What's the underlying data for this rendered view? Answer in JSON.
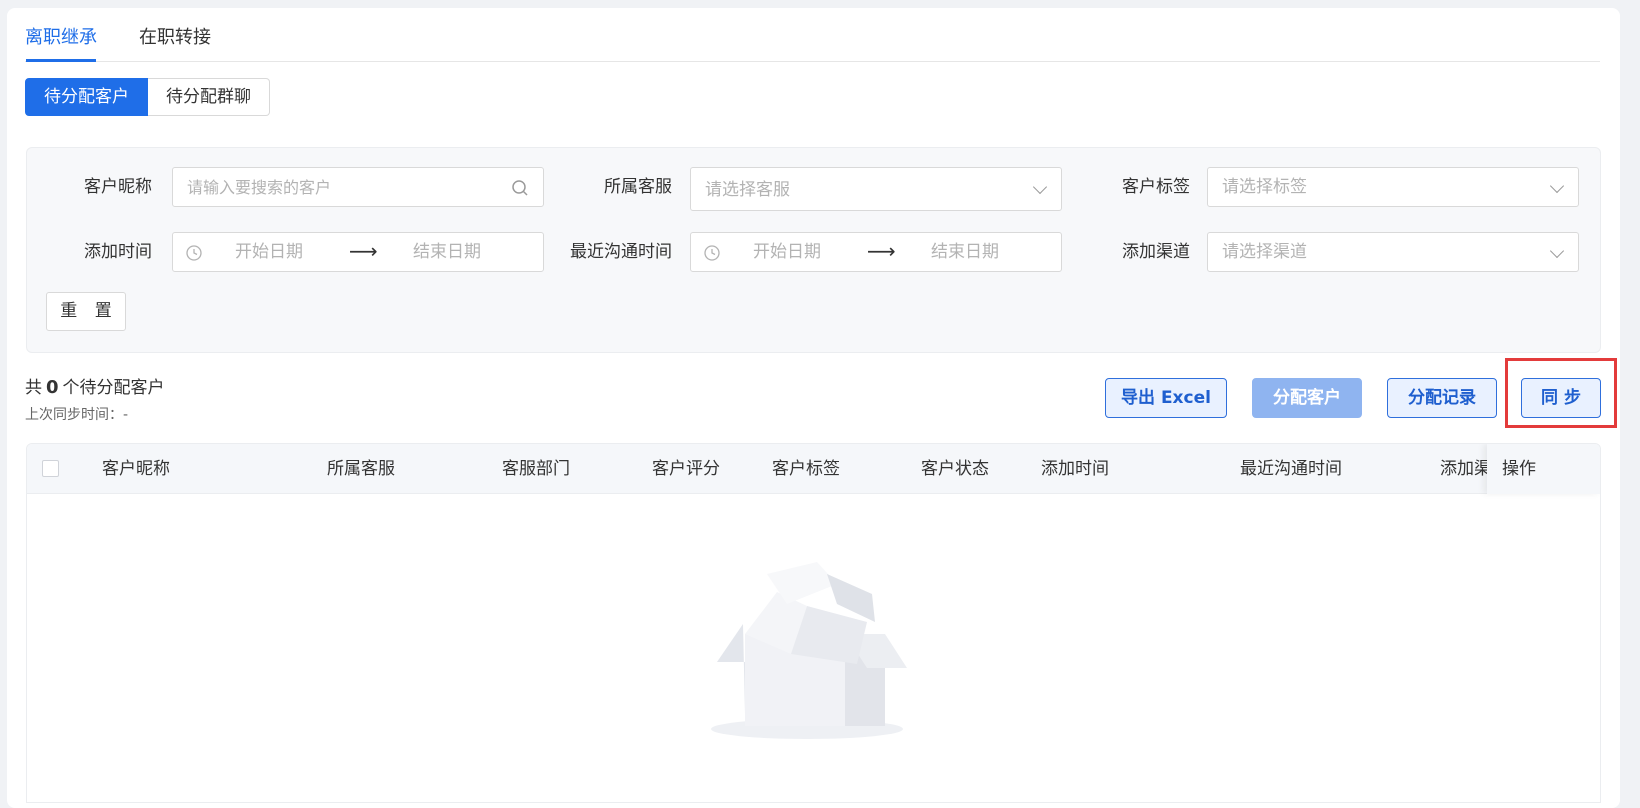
{
  "tabs": [
    {
      "label": "离职继承",
      "active": true
    },
    {
      "label": "在职转接",
      "active": false
    }
  ],
  "segments": [
    "待分配客户",
    "待分配群聊"
  ],
  "filters": {
    "nickname": {
      "label": "客户昵称",
      "placeholder": "请输入要搜索的客户"
    },
    "service": {
      "label": "所属客服",
      "placeholder": "请选择客服"
    },
    "tags": {
      "label": "客户标签",
      "placeholder": "请选择标签"
    },
    "add_time": {
      "label": "添加时间",
      "start": "开始日期",
      "end": "结束日期"
    },
    "last_contact": {
      "label": "最近沟通时间",
      "start": "开始日期",
      "end": "结束日期"
    },
    "channel": {
      "label": "添加渠道",
      "placeholder": "请选择渠道"
    },
    "reset_label": "重 置"
  },
  "summary": {
    "prefix": "共",
    "count": "0",
    "suffix": "个待分配客户",
    "last_sync": "上次同步时间：-"
  },
  "actions": {
    "export": "导出 Excel",
    "assign": "分配客户",
    "records": "分配记录",
    "sync": "同 步"
  },
  "table": {
    "columns": [
      "客户昵称",
      "所属客服",
      "客服部门",
      "客户评分",
      "客户标签",
      "客户状态",
      "添加时间",
      "最近沟通时间",
      "添加渠",
      "操作"
    ]
  },
  "colors": {
    "accent": "#1f6ee8",
    "highlight": "#e33b3b"
  },
  "icons": {
    "search": "search-icon",
    "clock": "clock-icon",
    "chevron": "chevron-down-icon",
    "empty": "empty-box-icon"
  }
}
